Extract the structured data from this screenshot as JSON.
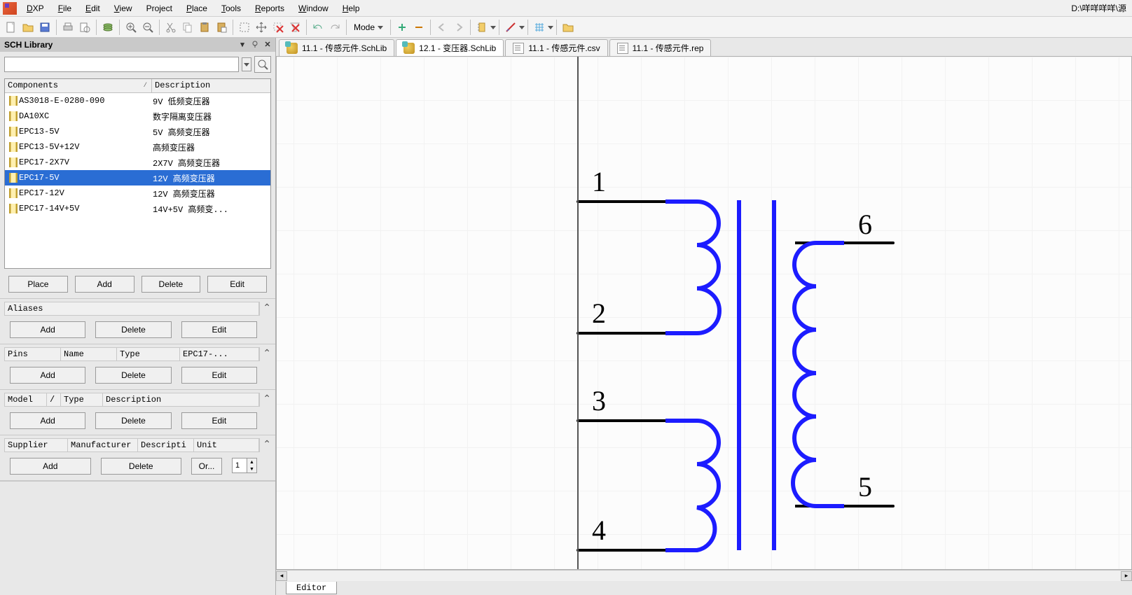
{
  "menu": {
    "brand": "DXP",
    "items": [
      "File",
      "Edit",
      "View",
      "Project",
      "Place",
      "Tools",
      "Reports",
      "Window",
      "Help"
    ],
    "path": "D:\\咩咩咩咩\\源"
  },
  "toolbar": {
    "mode_label": "Mode"
  },
  "sch_library": {
    "title": "SCH Library",
    "search": "",
    "headers": {
      "components": "Components",
      "description": "Description"
    },
    "rows": [
      {
        "name": "AS3018-E-0280-090",
        "desc": "9V 低频变压器",
        "selected": false
      },
      {
        "name": "DA10XC",
        "desc": "数字隔离变压器",
        "selected": false
      },
      {
        "name": "EPC13-5V",
        "desc": "5V 高频变压器",
        "selected": false
      },
      {
        "name": "EPC13-5V+12V",
        "desc": "高频变压器",
        "selected": false
      },
      {
        "name": "EPC17-2X7V",
        "desc": "2X7V 高频变压器",
        "selected": false
      },
      {
        "name": "EPC17-5V",
        "desc": "12V 高频变压器",
        "selected": true
      },
      {
        "name": "EPC17-12V",
        "desc": "12V 高频变压器",
        "selected": false
      },
      {
        "name": "EPC17-14V+5V",
        "desc": "14V+5V 高频变...",
        "selected": false
      }
    ],
    "buttons": {
      "place": "Place",
      "add": "Add",
      "delete": "Delete",
      "edit": "Edit"
    }
  },
  "aliases": {
    "header": "Aliases",
    "add": "Add",
    "delete": "Delete",
    "edit": "Edit"
  },
  "pins": {
    "headers": {
      "pins": "Pins",
      "name": "Name",
      "type": "Type",
      "value": "EPC17-..."
    },
    "add": "Add",
    "delete": "Delete",
    "edit": "Edit"
  },
  "model": {
    "headers": {
      "model": "Model",
      "slash": "/",
      "type": "Type",
      "desc": "Description"
    },
    "add": "Add",
    "delete": "Delete",
    "edit": "Edit"
  },
  "supplier": {
    "headers": {
      "supplier": "Supplier",
      "manufacturer": "Manufacturer",
      "desc": "Descripti",
      "unit": "Unit"
    },
    "add": "Add",
    "delete": "Delete",
    "or": "Or...",
    "qty": "1"
  },
  "tabs": [
    {
      "label": "11.1 - 传感元件.SchLib",
      "type": "sch",
      "active": false
    },
    {
      "label": "12.1 - 变压器.SchLib",
      "type": "sch",
      "active": true
    },
    {
      "label": "11.1 - 传感元件.csv",
      "type": "rep",
      "active": false
    },
    {
      "label": "11.1 - 传感元件.rep",
      "type": "rep",
      "active": false
    }
  ],
  "schematic": {
    "pin_labels": [
      "1",
      "2",
      "3",
      "4",
      "5",
      "6"
    ]
  },
  "editor_tab": "Editor"
}
